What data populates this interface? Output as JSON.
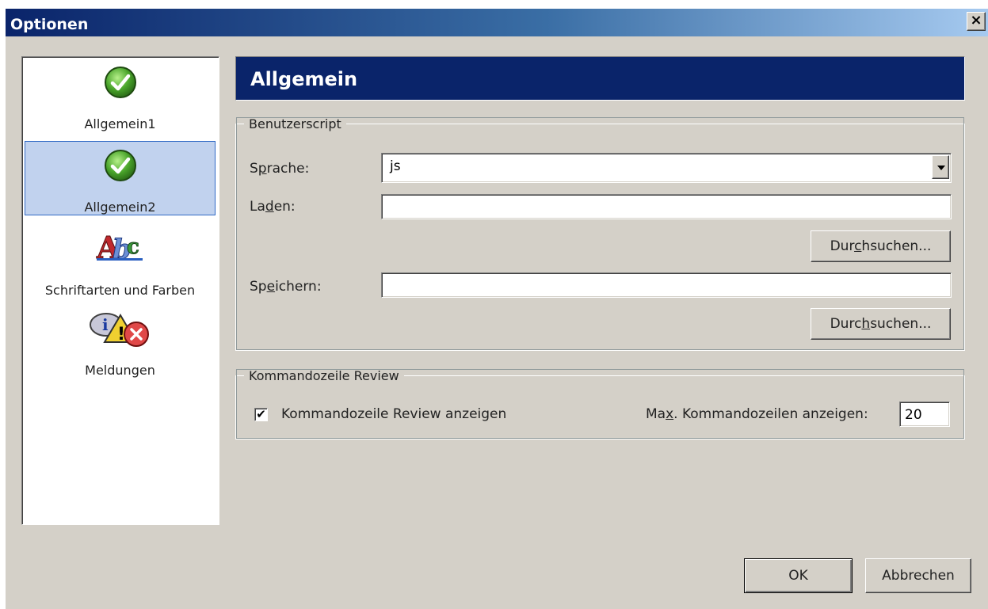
{
  "window": {
    "title": "Optionen"
  },
  "nav": {
    "items": [
      {
        "label": "Allgemein1",
        "icon": "check-icon",
        "selected": false
      },
      {
        "label": "Allgemein2",
        "icon": "check-icon",
        "selected": true
      },
      {
        "label": "Schriftarten und Farben",
        "icon": "fonts-colors-icon",
        "selected": false
      },
      {
        "label": "Meldungen",
        "icon": "messages-icon",
        "selected": false
      }
    ]
  },
  "banner": {
    "title": "Allgemein"
  },
  "userscript": {
    "legend": "Benutzerscript",
    "language_label_pre": "S",
    "language_label_key": "p",
    "language_label_post": "rache:",
    "language_value": "js",
    "load_label_pre": "La",
    "load_label_key": "d",
    "load_label_post": "en:",
    "load_value": "",
    "browse1_pre": "Dur",
    "browse1_key": "c",
    "browse1_post": "hsuchen...",
    "save_label_pre": "Sp",
    "save_label_key": "e",
    "save_label_post": "ichern:",
    "save_value": "",
    "browse2_pre": "Durc",
    "browse2_key": "h",
    "browse2_post": "suchen..."
  },
  "review": {
    "legend": "Kommandozeile Review",
    "show_checked": true,
    "show_label": "Kommandozeile Review anzeigen",
    "max_label_pre": "Ma",
    "max_label_key": "x",
    "max_label_post": ". Kommandozeilen anzeigen:",
    "max_value": "20"
  },
  "footer": {
    "ok_label": "OK",
    "cancel_label": "Abbrechen"
  },
  "colors": {
    "title_gradient_start": "#0a246a",
    "title_gradient_end": "#a6caf0",
    "banner": "#0a246a",
    "selection": "#c1d2ee"
  }
}
